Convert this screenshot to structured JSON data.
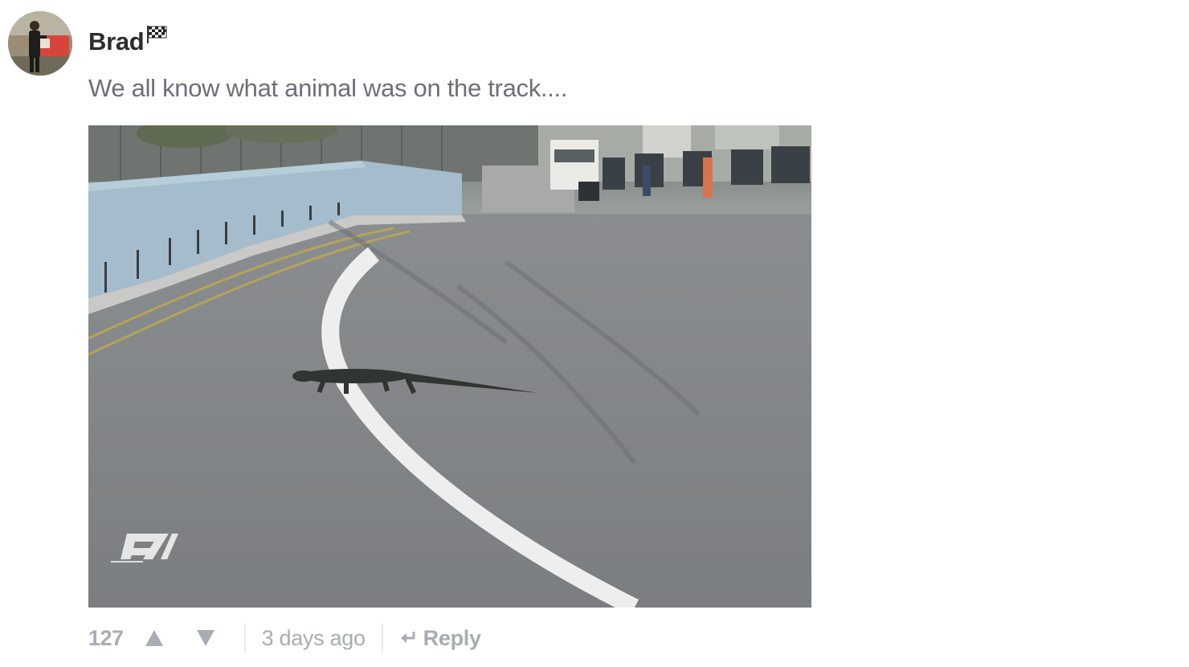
{
  "comment": {
    "author": "Brad",
    "author_badge_icon": "checkered-flag-icon",
    "text": "We all know what animal was on the track....",
    "media": {
      "kind": "image",
      "watermark_icon": "f1-logo-icon"
    },
    "footer": {
      "vote_count": "127",
      "upvote_icon": "triangle-up-icon",
      "downvote_icon": "triangle-down-icon",
      "timestamp": "3 days ago",
      "reply_icon": "reply-arrow-icon",
      "reply_label": "Reply"
    }
  },
  "colors": {
    "author": "#2a2e2e",
    "body_text": "#6d6f79",
    "muted": "#a9acb3",
    "separator": "#e7e9ee"
  }
}
